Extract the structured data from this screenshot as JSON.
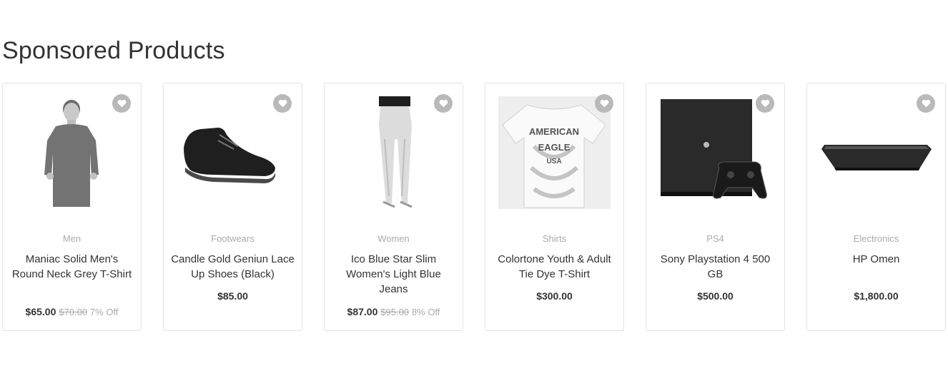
{
  "section": {
    "title": "Sponsored Products"
  },
  "products": [
    {
      "category": "Men",
      "name": "Maniac Solid Men's Round Neck Grey T-Shirt",
      "price": "$65.00",
      "old_price": "$70.00",
      "discount": "7% Off",
      "image_icon": "tshirt-model-image"
    },
    {
      "category": "Footwears",
      "name": "Candle Gold Geniun Lace Up Shoes (Black)",
      "price": "$85.00",
      "old_price": "",
      "discount": "",
      "image_icon": "shoe-image"
    },
    {
      "category": "Women",
      "name": "Ico Blue Star Slim Women's Light Blue Jeans",
      "price": "$87.00",
      "old_price": "$95.00",
      "discount": "8% Off",
      "image_icon": "jeans-image"
    },
    {
      "category": "Shirts",
      "name": "Colortone Youth & Adult Tie Dye T-Shirt",
      "price": "$300.00",
      "old_price": "",
      "discount": "",
      "image_icon": "tie-dye-shirt-image"
    },
    {
      "category": "PS4",
      "name": "Sony Playstation 4 500 GB",
      "price": "$500.00",
      "old_price": "",
      "discount": "",
      "image_icon": "playstation-image"
    },
    {
      "category": "Electronics",
      "name": "HP Omen",
      "price": "$1,800.00",
      "old_price": "",
      "discount": "",
      "image_icon": "laptop-image"
    }
  ],
  "shirt_print": {
    "line1": "AMERICAN",
    "line2": "EAGLE",
    "line3": "USA"
  },
  "colors": {
    "wishlist_bg": "#b9b9b9",
    "muted_text": "#aaaaaa",
    "card_border": "#e3e3e3"
  }
}
